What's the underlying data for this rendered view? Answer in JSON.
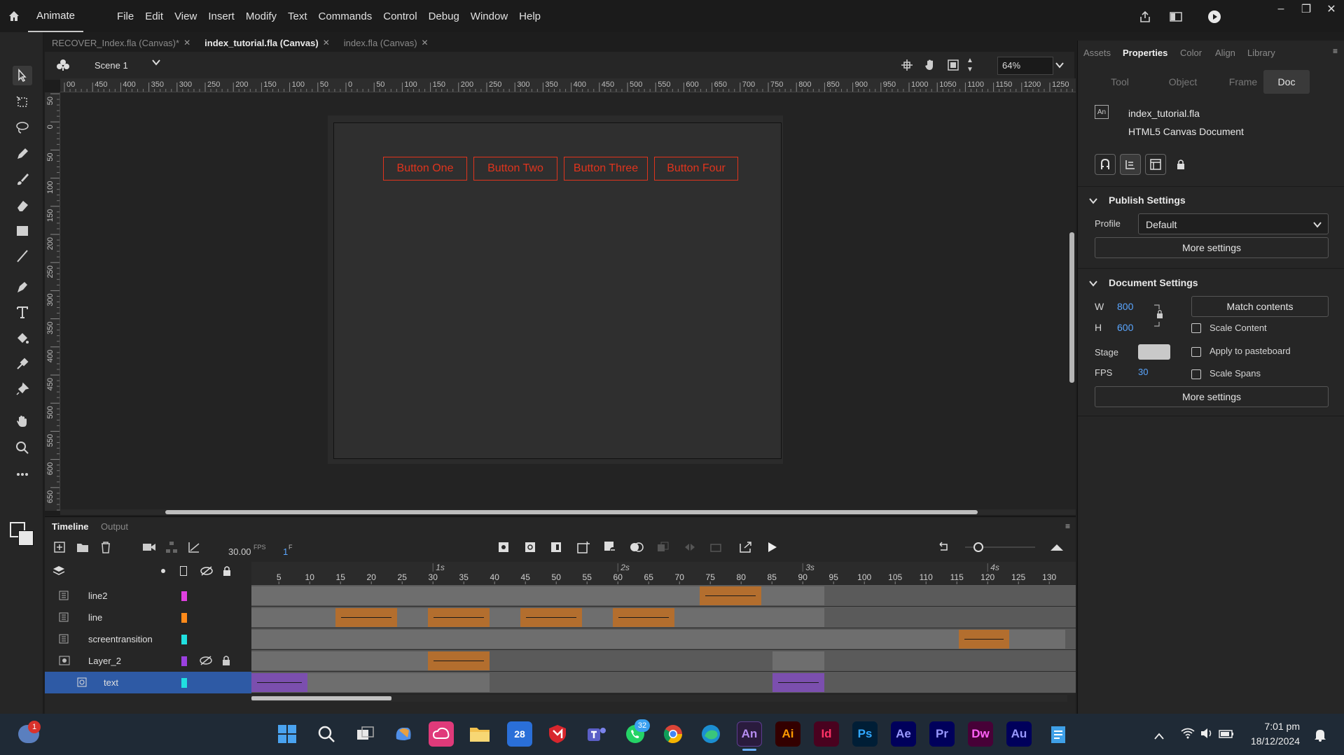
{
  "app": {
    "name": "Animate"
  },
  "menu": [
    "File",
    "Edit",
    "View",
    "Insert",
    "Modify",
    "Text",
    "Commands",
    "Control",
    "Debug",
    "Window",
    "Help"
  ],
  "doc_tabs": [
    {
      "label": "RECOVER_Index.fla (Canvas)*",
      "active": false
    },
    {
      "label": "index_tutorial.fla (Canvas)",
      "active": true
    },
    {
      "label": "index.fla (Canvas)",
      "active": false
    }
  ],
  "editbar": {
    "scene": "Scene 1",
    "zoom": "64%"
  },
  "ruler_h": [
    "00",
    "450",
    "400",
    "350",
    "300",
    "250",
    "200",
    "150",
    "100",
    "50",
    "0",
    "50",
    "100",
    "150",
    "200",
    "250",
    "300",
    "350",
    "400",
    "450",
    "500",
    "550",
    "600",
    "650",
    "700",
    "750",
    "800",
    "850",
    "900",
    "950",
    "1000",
    "1050",
    "1100",
    "1150",
    "1200",
    "1250",
    "130"
  ],
  "ruler_v": [
    "50",
    "0",
    "50",
    "100",
    "150",
    "200",
    "250",
    "300",
    "350",
    "400",
    "450",
    "500",
    "550",
    "600",
    "650"
  ],
  "stage_buttons": [
    "Button One",
    "Button Two",
    "Button Three",
    "Button Four"
  ],
  "timeline": {
    "tabs": [
      "Timeline",
      "Output"
    ],
    "fps": "30.00",
    "fps_unit": "FPS",
    "frame": "1",
    "frame_unit": "F",
    "seconds": [
      "1s",
      "2s",
      "3s",
      "4s"
    ],
    "frame_numbers": [
      "5",
      "10",
      "15",
      "20",
      "25",
      "30",
      "35",
      "40",
      "45",
      "50",
      "55",
      "60",
      "65",
      "70",
      "75",
      "80",
      "85",
      "90",
      "95",
      "100",
      "105",
      "110",
      "115",
      "120",
      "125",
      "130"
    ],
    "layers": [
      {
        "name": "line2",
        "color": "#e040e0",
        "selected": false
      },
      {
        "name": "line",
        "color": "#ff8a1a",
        "selected": false
      },
      {
        "name": "screentransition",
        "color": "#20e0e0",
        "selected": false
      },
      {
        "name": "Layer_2",
        "color": "#9b40e0",
        "selected": false
      },
      {
        "name": "text",
        "color": "#20e0e0",
        "selected": true
      }
    ]
  },
  "panel": {
    "tabs": [
      "Assets",
      "Properties",
      "Color",
      "Align",
      "Library"
    ],
    "active_tab": "Properties",
    "subtabs": [
      "Tool",
      "Object",
      "Frame",
      "Doc"
    ],
    "active_subtab": "Doc",
    "doc_badge": "An",
    "doc_name": "index_tutorial.fla",
    "doc_type": "HTML5 Canvas Document",
    "publish": {
      "title": "Publish Settings",
      "profile_label": "Profile",
      "profile_value": "Default",
      "more": "More settings"
    },
    "document": {
      "title": "Document Settings",
      "w_label": "W",
      "w": "800",
      "h_label": "H",
      "h": "600",
      "match": "Match contents",
      "scale_content": "Scale Content",
      "stage_label": "Stage",
      "apply": "Apply to pasteboard",
      "fps_label": "FPS",
      "fps": "30",
      "scale_spans": "Scale Spans",
      "more": "More settings"
    }
  },
  "taskbar": {
    "apps": [
      "An",
      "Ai",
      "Id",
      "Ps",
      "Ae",
      "Pr",
      "Dw",
      "Au"
    ],
    "whatsapp_badge": "32",
    "notif_badge": "1",
    "calendar_day": "28",
    "time": "7:01 pm",
    "date": "18/12/2024"
  }
}
